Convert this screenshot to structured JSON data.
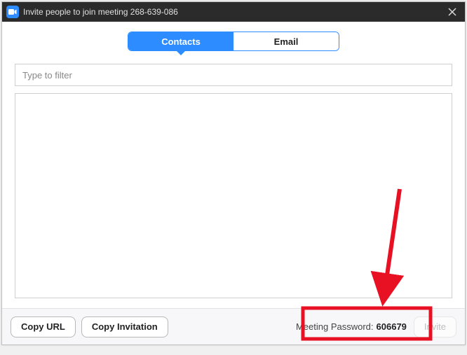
{
  "titlebar": {
    "title": "Invite people to join meeting 268-639-086"
  },
  "tabs": {
    "contacts": "Contacts",
    "email": "Email"
  },
  "filter": {
    "placeholder": "Type to filter"
  },
  "footer": {
    "copy_url": "Copy URL",
    "copy_invitation": "Copy Invitation",
    "password_label": "Meeting Password:",
    "password_value": "606679",
    "invite": "Invite"
  },
  "colors": {
    "accent": "#2D8CFF",
    "titlebar_bg": "#2b2b2b",
    "annotation": "#E81123"
  }
}
